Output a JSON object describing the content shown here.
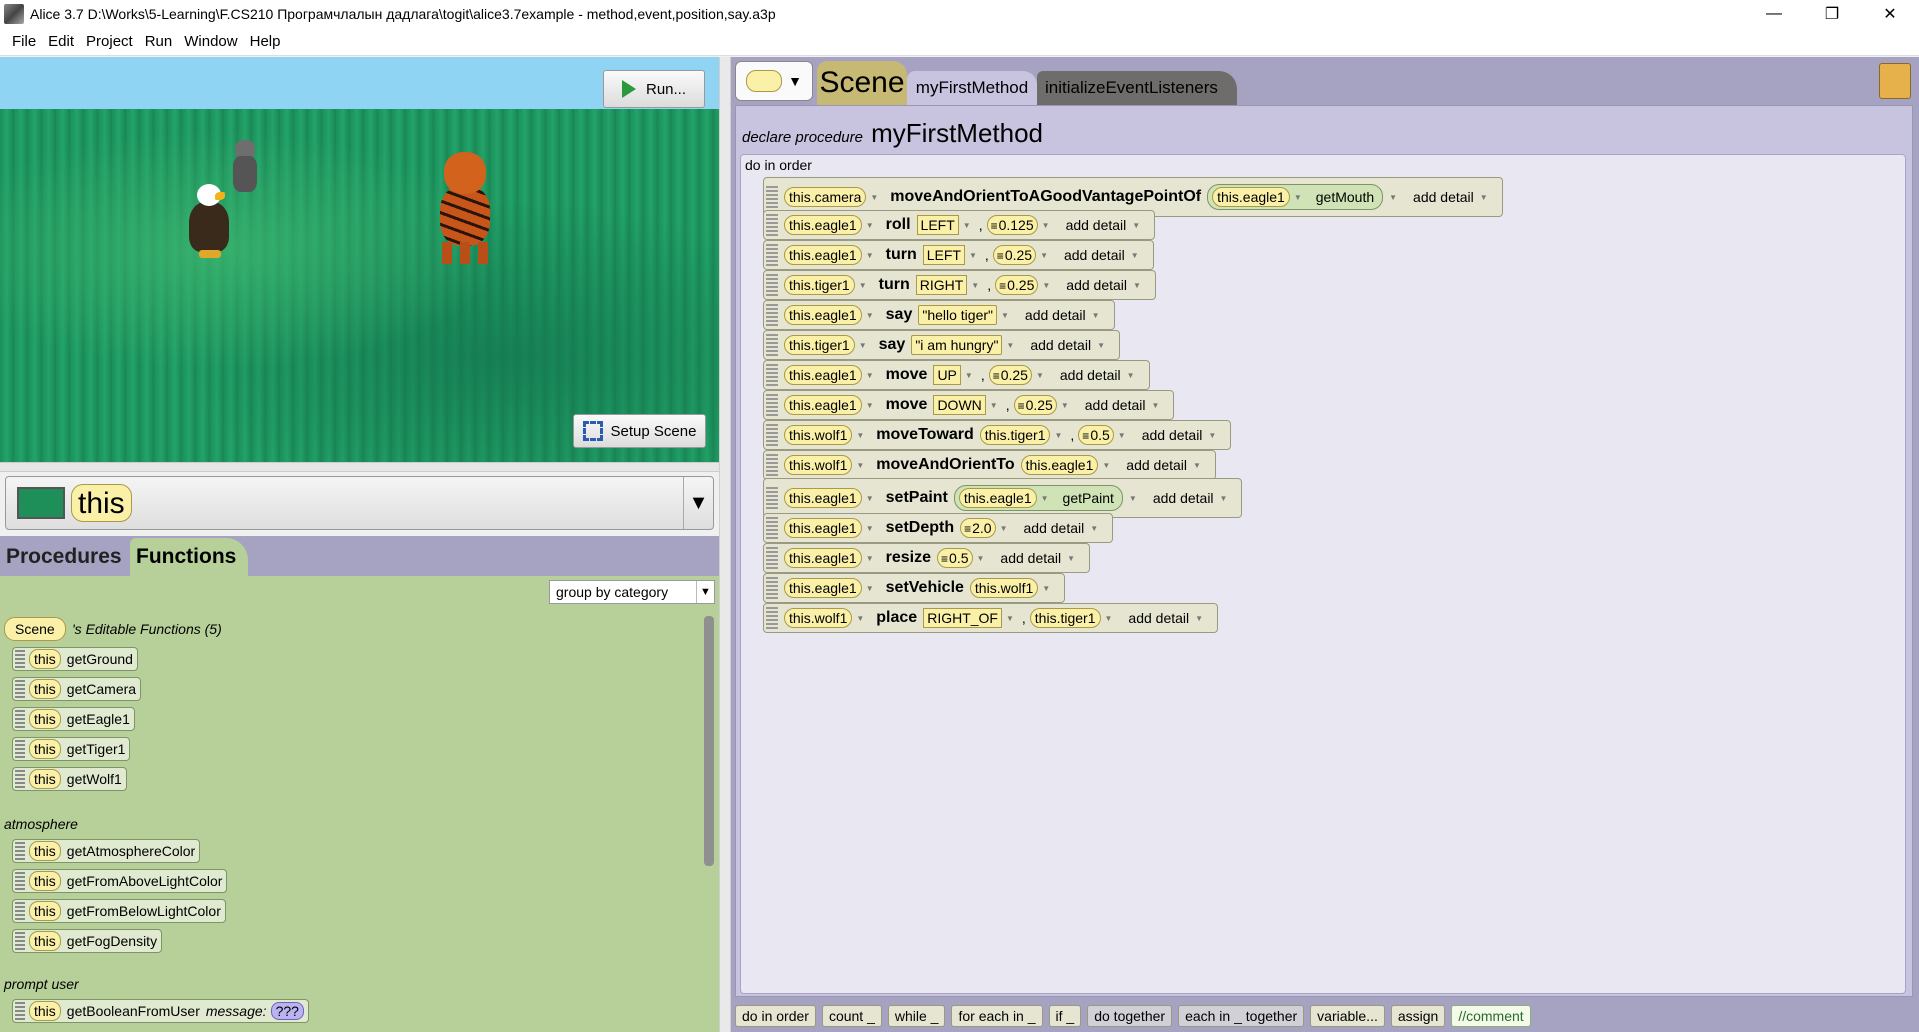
{
  "window": {
    "title": "Alice 3.7 D:\\Works\\5-Learning\\F.CS210 Програмчлалын дадлага\\togit\\alice3.7example - method,event,position,say.a3p",
    "minimize": "—",
    "restore": "❐",
    "close": "✕"
  },
  "menu": [
    "File",
    "Edit",
    "Project",
    "Run",
    "Window",
    "Help"
  ],
  "scene_view": {
    "run_label": "Run...",
    "setup_label": "Setup Scene"
  },
  "instance": {
    "name": "this",
    "dropdown": "▼"
  },
  "left_tabs": {
    "procedures": "Procedures",
    "functions": "Functions"
  },
  "functions_panel": {
    "group_by": "group by category",
    "scene_tile": "Scene",
    "editable_label": "'s Editable Functions (5)",
    "editable": [
      {
        "this": "this",
        "name": "getGround"
      },
      {
        "this": "this",
        "name": "getCamera"
      },
      {
        "this": "this",
        "name": "getEagle1"
      },
      {
        "this": "this",
        "name": "getTiger1"
      },
      {
        "this": "this",
        "name": "getWolf1"
      }
    ],
    "atmosphere_label": "atmosphere",
    "atmosphere": [
      {
        "this": "this",
        "name": "getAtmosphereColor"
      },
      {
        "this": "this",
        "name": "getFromAboveLightColor"
      },
      {
        "this": "this",
        "name": "getFromBelowLightColor"
      },
      {
        "this": "this",
        "name": "getFogDensity"
      }
    ],
    "prompt_label": "prompt user",
    "prompt": {
      "this": "this",
      "name": "getBooleanFromUser",
      "message": "message:",
      "value": "???"
    }
  },
  "editor": {
    "scene_tab": "Scene",
    "tabs": [
      "myFirstMethod",
      "initializeEventListeners"
    ],
    "declare": "declare procedure",
    "method_name": "myFirstMethod",
    "do_in_order": "do in order",
    "add_detail": "add detail",
    "statements": [
      {
        "target": "this.camera",
        "verb": "moveAndOrientToAGoodVantagePointOf",
        "fn_target": "this.eagle1",
        "fn_name": "getMouth"
      },
      {
        "target": "this.eagle1",
        "verb": "roll",
        "a1": "LEFT",
        "a2": "0.125"
      },
      {
        "target": "this.eagle1",
        "verb": "turn",
        "a1": "LEFT",
        "a2": "0.25"
      },
      {
        "target": "this.tiger1",
        "verb": "turn",
        "a1": "RIGHT",
        "a2": "0.25"
      },
      {
        "target": "this.eagle1",
        "verb": "say",
        "a1": "\"hello tiger\""
      },
      {
        "target": "this.tiger1",
        "verb": "say",
        "a1": "\"i am hungry\""
      },
      {
        "target": "this.eagle1",
        "verb": "move",
        "a1": "UP",
        "a2": "0.25"
      },
      {
        "target": "this.eagle1",
        "verb": "move",
        "a1": "DOWN",
        "a2": "0.25"
      },
      {
        "target": "this.wolf1",
        "verb": "moveToward",
        "a1": "this.tiger1",
        "a2": "0.5"
      },
      {
        "target": "this.wolf1",
        "verb": "moveAndOrientTo",
        "a1": "this.eagle1"
      },
      {
        "target": "this.eagle1",
        "verb": "setPaint",
        "fn_target": "this.eagle1",
        "fn_name": "getPaint"
      },
      {
        "target": "this.eagle1",
        "verb": "setDepth",
        "a1": "2.0"
      },
      {
        "target": "this.eagle1",
        "verb": "resize",
        "a1": "0.5"
      },
      {
        "target": "this.eagle1",
        "verb": "setVehicle",
        "a1": "this.wolf1"
      },
      {
        "target": "this.wolf1",
        "verb": "place",
        "a1": "RIGHT_OF",
        "a2": "this.tiger1"
      }
    ]
  },
  "palette": [
    "do in order",
    "count _",
    "while _",
    "for each in _",
    "if _",
    "do together",
    "each in _ together",
    "variable...",
    "assign",
    "//comment"
  ]
}
